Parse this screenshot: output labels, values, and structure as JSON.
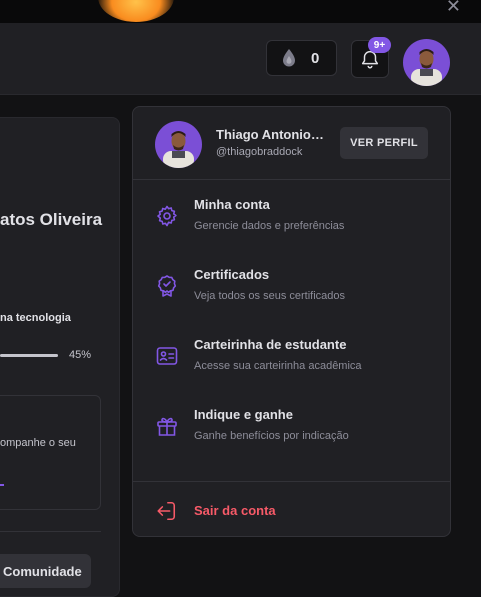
{
  "header": {
    "streak_count": "0",
    "notification_badge": "9+"
  },
  "background": {
    "student_name_partial": "atos Oliveira",
    "tech_label_partial": "na tecnologia",
    "progress_percent_label": "45%",
    "progress_value": 0.45,
    "box_text_partial": "ompanhe o seu",
    "community_button": "Comunidade"
  },
  "menu": {
    "user_name": "Thiago Antonio…",
    "user_handle": "@thiagobraddock",
    "profile_button": "VER PERFIL",
    "items": [
      {
        "icon": "gear-icon",
        "title": "Minha conta",
        "description": "Gerencie dados e preferências"
      },
      {
        "icon": "certificate-icon",
        "title": "Certificados",
        "description": "Veja todos os seus certificados"
      },
      {
        "icon": "id-card-icon",
        "title": "Carteirinha de estudante",
        "description": "Acesse sua carteirinha acadêmica"
      },
      {
        "icon": "gift-icon",
        "title": "Indique e ganhe",
        "description": "Ganhe benefícios por indicação"
      }
    ],
    "logout_label": "Sair da conta"
  },
  "colors": {
    "accent": "#8257e5",
    "danger": "#f75a68",
    "surface": "#202024",
    "background": "#121214"
  }
}
